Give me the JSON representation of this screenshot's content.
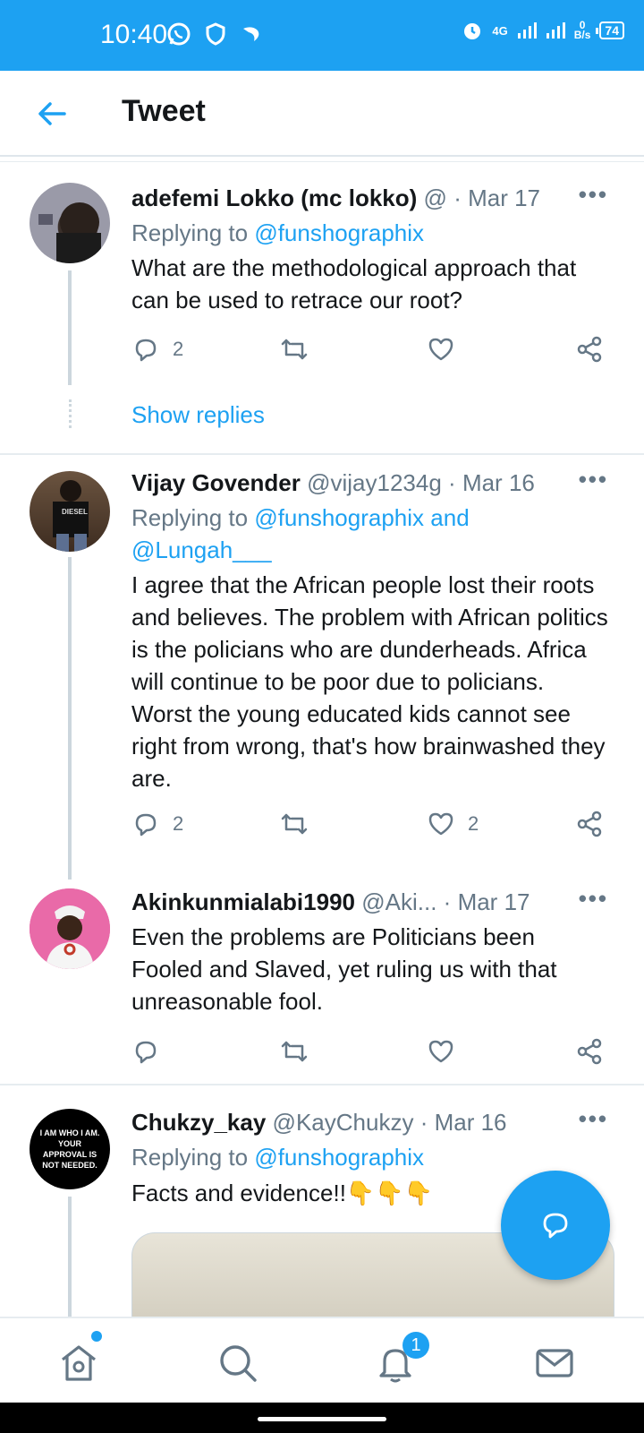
{
  "status_bar": {
    "time": "10:40",
    "network": "4G",
    "speed_value": "0",
    "speed_unit": "B/s",
    "battery": "74"
  },
  "header": {
    "title": "Tweet"
  },
  "tweets": [
    {
      "name": "adefemi Lokko (mc lokko)",
      "handle": "@",
      "dot": "·",
      "date": "Mar 17",
      "reply_prefix": "Replying to ",
      "reply_targets": "@funshographix",
      "body": "What are the methodological approach that can be used to retrace our root?",
      "reply_count": "2",
      "retweet_count": "",
      "like_count": "",
      "show_replies": "Show replies"
    },
    {
      "name": "Vijay Govender",
      "handle": "@vijay1234g",
      "dot": "·",
      "date": "Mar 16",
      "reply_prefix": "Replying to ",
      "reply_targets_1": "@funshographix",
      "reply_and": " and",
      "reply_targets_2": "@Lungah___",
      "body": "I agree that the African people lost their roots and believes. The problem with African politics is the policians who  are dunderheads. Africa will continue to be poor due to policians. Worst the young educated kids cannot see right from wrong, that's how brainwashed they are.",
      "reply_count": "2",
      "retweet_count": "",
      "like_count": "2"
    },
    {
      "name": "Akinkunmialabi1990",
      "handle": "@Aki...",
      "dot": "·",
      "date": "Mar 17",
      "body": "Even the problems are Politicians been Fooled and Slaved, yet ruling us with that unreasonable fool.",
      "reply_count": "",
      "retweet_count": "",
      "like_count": ""
    },
    {
      "name": "Chukzy_kay",
      "handle": "@KayChukzy",
      "dot": "·",
      "date": "Mar 16",
      "reply_prefix": "Replying to ",
      "reply_targets": "@funshographix",
      "body": "Facts and evidence!!",
      "emoji": "👇👇👇",
      "avatar_text": "I AM WHO I AM. YOUR APPROVAL IS NOT NEEDED."
    }
  ],
  "bottom_nav": {
    "notification_badge": "1"
  },
  "colors": {
    "accent": "#1da1f2",
    "text": "#14171a",
    "muted": "#657786"
  }
}
